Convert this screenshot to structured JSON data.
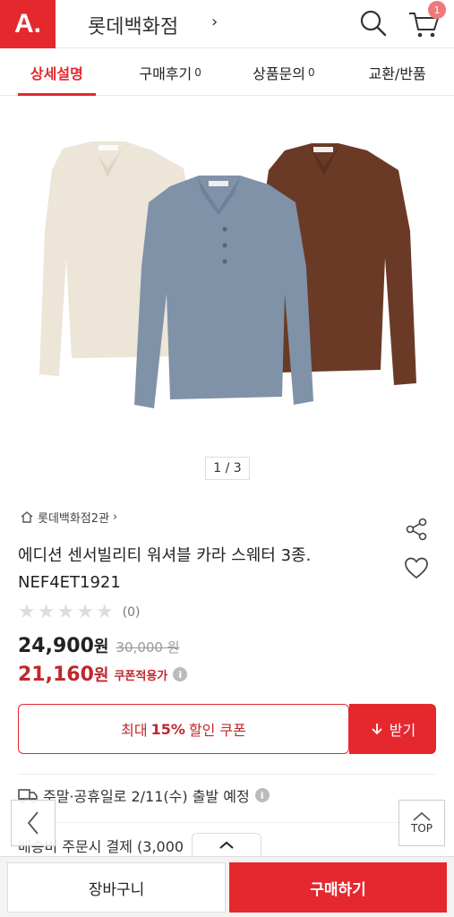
{
  "header": {
    "logo": "A.",
    "store_name": "롯데백화점",
    "chevron": "›",
    "cart_count": "1"
  },
  "tabs": [
    {
      "label": "상세설명",
      "count": ""
    },
    {
      "label": "구매후기",
      "count": "0"
    },
    {
      "label": "상품문의",
      "count": "0"
    },
    {
      "label": "교환/반품",
      "count": ""
    }
  ],
  "image_pager": "1 / 3",
  "product": {
    "store_link": "롯데백화점2관",
    "title_line1": "에디션 센서빌리티 워셔블 카라 스웨터 3종.",
    "title_line2": "NEF4ET1921",
    "rating_count": "(0)",
    "price": "24,900",
    "price_unit": "원",
    "original_price": "30,000 원",
    "sale_price": "21,160",
    "sale_unit": "원",
    "coupon_note": "쿠폰적용가"
  },
  "coupon": {
    "prefix": "최대",
    "rate": "15%",
    "suffix": "할인 쿠폰",
    "button": "받기"
  },
  "shipping": {
    "text": "주말·공휴일로 2/11(수) 출발 예정",
    "fee": "배송비 주문시 결제 (3,000"
  },
  "top_label": "TOP",
  "bottom": {
    "cart": "장바구니",
    "buy": "구매하기"
  },
  "colors": {
    "accent": "#e5282e",
    "sale": "#c0272d",
    "sweater_left": "#ece5d8",
    "sweater_center": "#7f92a8",
    "sweater_right": "#6b3a26"
  }
}
